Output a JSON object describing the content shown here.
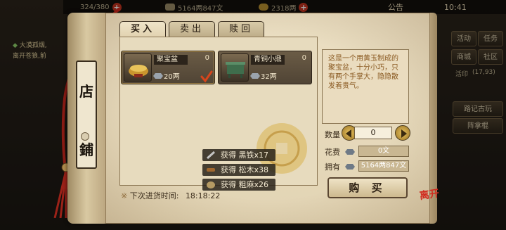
{
  "topbar": {
    "stamina": "324/380",
    "copper": "5164两847文",
    "gold": "2318两",
    "notice": "公告",
    "time": "10:41"
  },
  "left_quest": {
    "line1": "大漠孤烟,",
    "line2": "离开苍狼,前"
  },
  "right_menu": {
    "activity": "活动",
    "tasks": "任务",
    "shop": "商城",
    "community": "社区",
    "guide": "活印",
    "coords": "(17,93)",
    "journal": "路记古玩",
    "recruit": "阵拿棍"
  },
  "shop": {
    "title_char1": "店",
    "title_char2": "鋪",
    "tabs": [
      "买入",
      "卖出",
      "赎回"
    ],
    "restock_prefix": "※",
    "restock_label": "下次进货时间:",
    "restock_time": "18:18:22"
  },
  "items": [
    {
      "name": "聚宝盆",
      "count": "0",
      "price": "20两",
      "selected": true
    },
    {
      "name": "青铜小鼎",
      "count": "0",
      "price": "32两",
      "selected": false
    }
  ],
  "detail": {
    "description": "这是一个用黄玉制成的聚宝盆，十分小巧，只有两个手掌大，隐隐散发着贵气。",
    "qty_label": "数量",
    "qty_value": "0",
    "cost_label": "花费",
    "cost_value": "0文",
    "own_label": "拥有",
    "own_value": "5164两847文",
    "buy_label": "购 买"
  },
  "toasts": [
    {
      "prefix": "获得",
      "text": "黑铁x17"
    },
    {
      "prefix": "获得",
      "text": "松木x38"
    },
    {
      "prefix": "获得",
      "text": "粗麻x26"
    }
  ],
  "seal_text": "离开",
  "colors": {
    "parchment": "#e7dbbe",
    "accent_red": "#c2341f",
    "description_text": "#8a5a22"
  }
}
